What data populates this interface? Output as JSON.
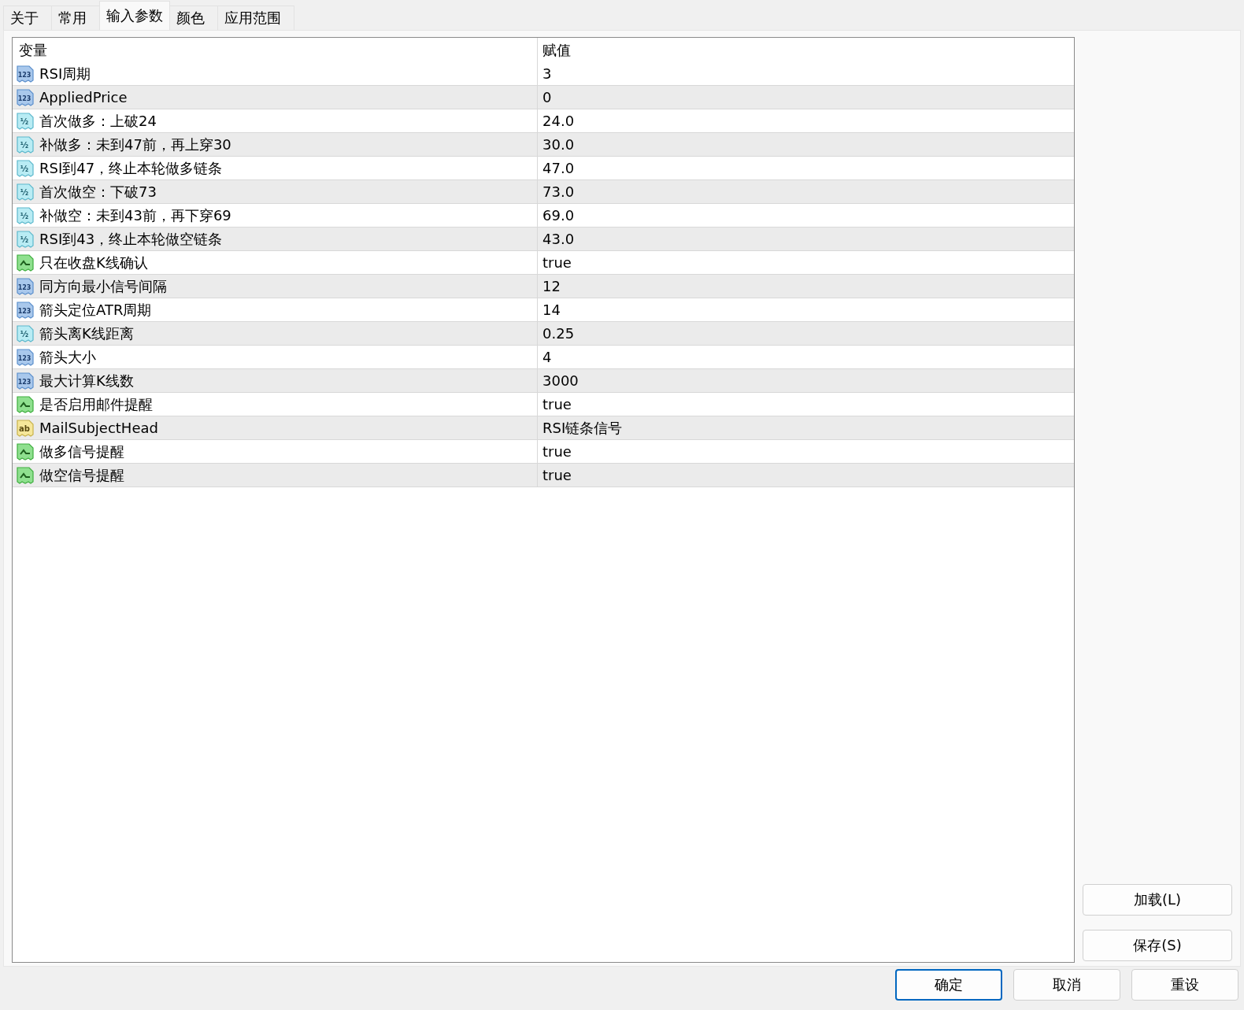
{
  "tabs": [
    {
      "label": "关于",
      "selected": false
    },
    {
      "label": "常用",
      "selected": false
    },
    {
      "label": "输入参数",
      "selected": true
    },
    {
      "label": "颜色",
      "selected": false
    },
    {
      "label": "应用范围",
      "selected": false
    }
  ],
  "table": {
    "columns": [
      "变量",
      "赋值"
    ],
    "rows": [
      {
        "kind": "int",
        "type_label": "123",
        "name": "RSI周期",
        "value": "3"
      },
      {
        "kind": "int",
        "type_label": "123",
        "name": "AppliedPrice",
        "value": "0"
      },
      {
        "kind": "double",
        "type_label": "½",
        "name": "首次做多：上破24",
        "value": "24.0"
      },
      {
        "kind": "double",
        "type_label": "½",
        "name": "补做多：未到47前，再上穿30",
        "value": "30.0"
      },
      {
        "kind": "double",
        "type_label": "½",
        "name": "RSI到47，终止本轮做多链条",
        "value": "47.0"
      },
      {
        "kind": "double",
        "type_label": "½",
        "name": "首次做空：下破73",
        "value": "73.0"
      },
      {
        "kind": "double",
        "type_label": "½",
        "name": "补做空：未到43前，再下穿69",
        "value": "69.0"
      },
      {
        "kind": "double",
        "type_label": "½",
        "name": "RSI到43，终止本轮做空链条",
        "value": "43.0"
      },
      {
        "kind": "bool",
        "name": "只在收盘K线确认",
        "value": "true"
      },
      {
        "kind": "int",
        "type_label": "123",
        "name": "同方向最小信号间隔",
        "value": "12"
      },
      {
        "kind": "int",
        "type_label": "123",
        "name": "箭头定位ATR周期",
        "value": "14"
      },
      {
        "kind": "double",
        "type_label": "½",
        "name": "箭头离K线距离",
        "value": "0.25"
      },
      {
        "kind": "int",
        "type_label": "123",
        "name": "箭头大小",
        "value": "4"
      },
      {
        "kind": "int",
        "type_label": "123",
        "name": "最大计算K线数",
        "value": "3000"
      },
      {
        "kind": "bool",
        "name": "是否启用邮件提醒",
        "value": "true"
      },
      {
        "kind": "string",
        "type_label": "ab",
        "name": "MailSubjectHead",
        "value": "RSI链条信号"
      },
      {
        "kind": "bool",
        "name": "做多信号提醒",
        "value": "true"
      },
      {
        "kind": "bool",
        "name": "做空信号提醒",
        "value": "true"
      }
    ]
  },
  "side_buttons": [
    "加载(L)",
    "保存(S)"
  ],
  "buttons": [
    {
      "label": "确定",
      "focused": true
    },
    {
      "label": "取消",
      "focused": false
    },
    {
      "label": "重设",
      "focused": false
    }
  ]
}
